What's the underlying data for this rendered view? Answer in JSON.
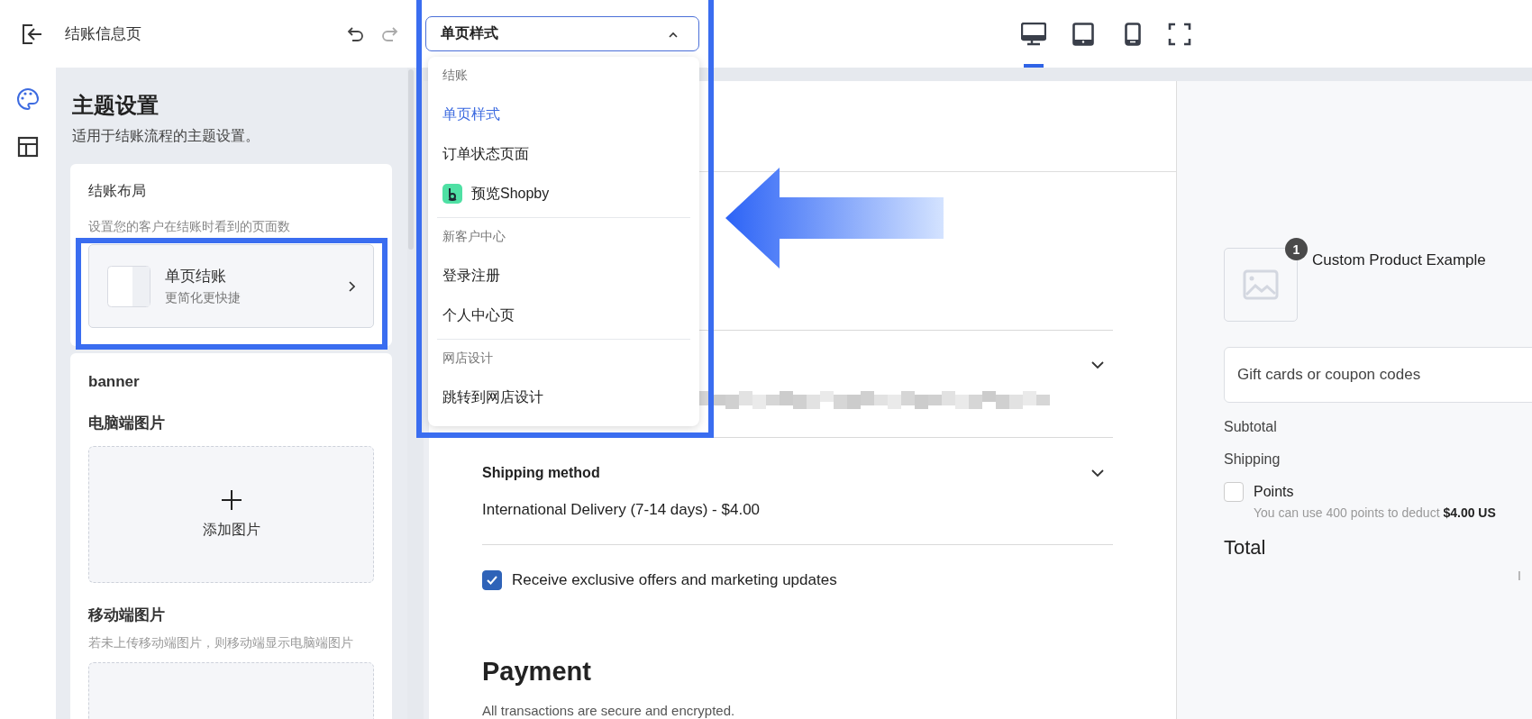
{
  "topbar": {
    "title": "结账信息页",
    "page_select": {
      "value": "单页样式",
      "expanded": true
    },
    "devices": [
      {
        "kind": "desktop",
        "selected": true
      },
      {
        "kind": "tablet",
        "selected": false
      },
      {
        "kind": "mobile",
        "selected": false
      }
    ]
  },
  "rail": [
    {
      "kind": "palette",
      "selected": true
    },
    {
      "kind": "layout",
      "selected": false
    }
  ],
  "panel": {
    "title": "主题设置",
    "subtitle": "适用于结账流程的主题设置。",
    "layout_card": {
      "title": "结账布局",
      "description": "设置您的客户在结账时看到的页面数",
      "option_title": "单页结账",
      "option_subtitle": "更简化更快捷"
    },
    "banner_card": {
      "title": "banner",
      "desktop_label": "电脑端图片",
      "add_label": "添加图片",
      "mobile_label": "移动端图片",
      "mobile_hint": "若未上传移动端图片，则移动端显示电脑端图片"
    }
  },
  "dropdown": {
    "groups": [
      {
        "label": "结账",
        "items": [
          {
            "label": "单页样式",
            "selected": true
          },
          {
            "label": "订单状态页面",
            "selected": false
          },
          {
            "label": "预览Shopby",
            "selected": false,
            "kind": "brand"
          }
        ]
      },
      {
        "label": "新客户中心",
        "items": [
          {
            "label": "登录注册",
            "selected": false
          },
          {
            "label": "个人中心页",
            "selected": false
          }
        ]
      },
      {
        "label": "网店设计",
        "items": [
          {
            "label": "跳转到网店设计",
            "selected": false
          }
        ]
      }
    ]
  },
  "preview": {
    "shipping": {
      "title": "Shipping method",
      "value": "International Delivery (7-14 days) - $4.00"
    },
    "marketing": {
      "label": "Receive exclusive offers and marketing updates",
      "checked": true
    },
    "payment": {
      "title": "Payment",
      "subtitle": "All transactions are secure and encrypted."
    },
    "summary": {
      "product": {
        "name": "Custom Product Example",
        "quantity": "1"
      },
      "coupon": {
        "placeholder": "Gift cards or coupon codes"
      },
      "subtotal_label": "Subtotal",
      "shipping_label": "Shipping",
      "points": {
        "label": "Points",
        "checked": false,
        "hint": "You can use 400 points to deduct **$4.00 US**"
      },
      "total_label": "Total",
      "cut_text": "I"
    }
  }
}
